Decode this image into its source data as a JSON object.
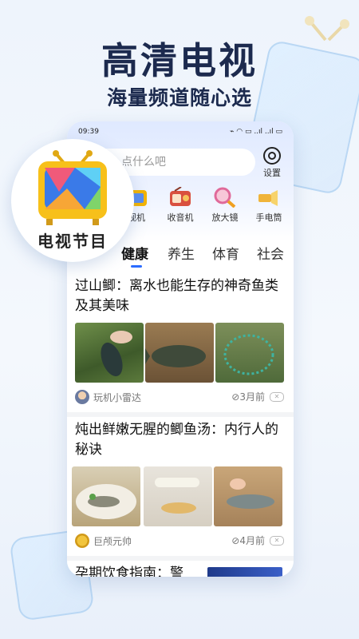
{
  "hero": {
    "title": "高清电视",
    "subtitle": "海量频道随心选"
  },
  "status_bar": {
    "time": "09:39",
    "right": "⌁ ◠ ▭ ..ıl ..ıl ▭"
  },
  "search": {
    "placeholder": "点什么吧"
  },
  "settings": {
    "label": "设置"
  },
  "tools": [
    {
      "label": "视机",
      "icon": "tv-icon"
    },
    {
      "label": "收音机",
      "icon": "radio-icon"
    },
    {
      "label": "放大镜",
      "icon": "magnifier-icon"
    },
    {
      "label": "手电筒",
      "icon": "flashlight-icon"
    }
  ],
  "tabs": [
    "健康",
    "养生",
    "体育",
    "社会"
  ],
  "tv_badge": {
    "label": "电视节目"
  },
  "articles": [
    {
      "title": "过山鲫：离水也能生存的神奇鱼类及其美味",
      "author": "玩机小雷达",
      "time": "3月前"
    },
    {
      "title": "炖出鲜嫩无腥的鲫鱼汤：内行人的秘诀",
      "author": "巨颅元帅",
      "time": "4月前"
    },
    {
      "title": "孕期饮食指南：警"
    }
  ],
  "colors": {
    "accent": "#2b6cff",
    "title": "#1c2a4e"
  }
}
